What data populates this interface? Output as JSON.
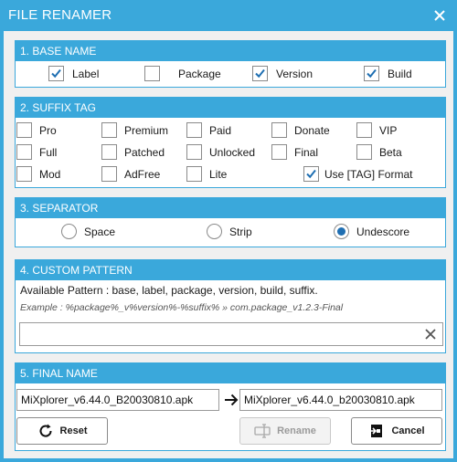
{
  "window": {
    "title": "FILE RENAMER"
  },
  "base_name": {
    "header": "1. BASE NAME",
    "options": [
      {
        "label": "Label",
        "checked": true
      },
      {
        "label": "Package",
        "checked": false
      },
      {
        "label": "Version",
        "checked": true
      },
      {
        "label": "Build",
        "checked": true
      }
    ]
  },
  "suffix_tag": {
    "header": "2. SUFFIX TAG",
    "options": [
      {
        "label": "Pro",
        "checked": false
      },
      {
        "label": "Premium",
        "checked": false
      },
      {
        "label": "Paid",
        "checked": false
      },
      {
        "label": "Donate",
        "checked": false
      },
      {
        "label": "VIP",
        "checked": false
      },
      {
        "label": "Full",
        "checked": false
      },
      {
        "label": "Patched",
        "checked": false
      },
      {
        "label": "Unlocked",
        "checked": false
      },
      {
        "label": "Final",
        "checked": false
      },
      {
        "label": "Beta",
        "checked": false
      },
      {
        "label": "Mod",
        "checked": false
      },
      {
        "label": "AdFree",
        "checked": false
      },
      {
        "label": "Lite",
        "checked": false
      },
      {
        "label": "Use [TAG] Format",
        "checked": true
      }
    ]
  },
  "separator": {
    "header": "3. SEPARATOR",
    "options": [
      {
        "label": "Space",
        "selected": false
      },
      {
        "label": "Strip",
        "selected": false
      },
      {
        "label": "Undescore",
        "selected": true
      }
    ]
  },
  "custom_pattern": {
    "header": "4. CUSTOM PATTERN",
    "info": "Available Pattern : base, label, package, version, build, suffix.",
    "example": "Example : %package%_v%version%-%suffix% » com.package_v1.2.3-Final",
    "value": "",
    "placeholder": ""
  },
  "final_name": {
    "header": "5. FINAL NAME",
    "original": "MiXplorer_v6.44.0_B20030810.apk",
    "renamed": "MiXplorer_v6.44.0_b20030810.apk",
    "reset_label": "Reset",
    "rename_label": "Rename",
    "cancel_label": "Cancel"
  },
  "colors": {
    "accent": "#3aa8db",
    "radio_dot": "#1f6fb2",
    "checkmark": "#1f6fb2"
  },
  "icons": {
    "close": "close-icon",
    "check": "checkmark-icon",
    "clear": "clear-x-icon",
    "arrow": "arrow-right-icon",
    "reset": "refresh-icon",
    "rename": "rename-icon",
    "cancel": "exit-icon"
  }
}
